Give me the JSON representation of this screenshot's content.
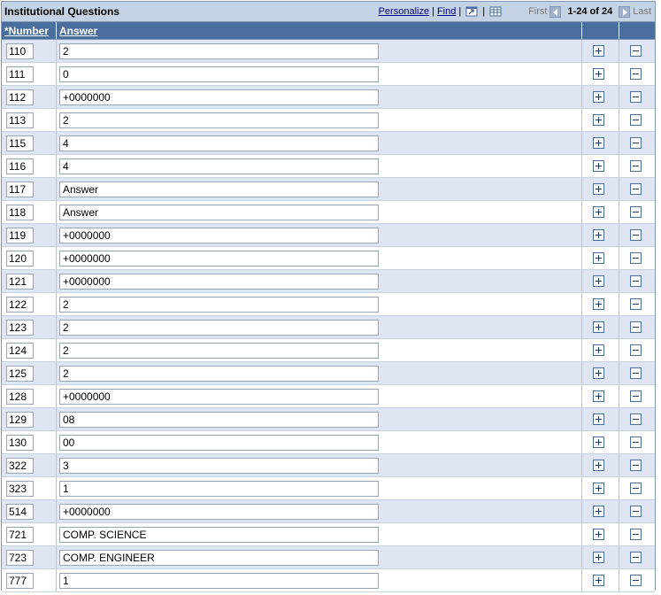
{
  "grid": {
    "title": "Institutional Questions",
    "nav": {
      "personalize": "Personalize",
      "find": "Find",
      "first": "First",
      "range": "1-24 of 24",
      "last": "Last"
    },
    "columns": {
      "number": "*Number",
      "answer": "Answer"
    },
    "rows": [
      {
        "number": "110",
        "answer": "2"
      },
      {
        "number": "111",
        "answer": "0"
      },
      {
        "number": "112",
        "answer": "+0000000"
      },
      {
        "number": "113",
        "answer": "2"
      },
      {
        "number": "115",
        "answer": "4"
      },
      {
        "number": "116",
        "answer": "4"
      },
      {
        "number": "117",
        "answer": "Answer"
      },
      {
        "number": "118",
        "answer": "Answer"
      },
      {
        "number": "119",
        "answer": "+0000000"
      },
      {
        "number": "120",
        "answer": "+0000000"
      },
      {
        "number": "121",
        "answer": "+0000000"
      },
      {
        "number": "122",
        "answer": "2"
      },
      {
        "number": "123",
        "answer": "2"
      },
      {
        "number": "124",
        "answer": "2"
      },
      {
        "number": "125",
        "answer": "2"
      },
      {
        "number": "128",
        "answer": "+0000000"
      },
      {
        "number": "129",
        "answer": "08"
      },
      {
        "number": "130",
        "answer": "00"
      },
      {
        "number": "322",
        "answer": "3"
      },
      {
        "number": "323",
        "answer": "1"
      },
      {
        "number": "514",
        "answer": "+0000000"
      },
      {
        "number": "721",
        "answer": "COMP. SCIENCE"
      },
      {
        "number": "723",
        "answer": "COMP. ENGINEER"
      },
      {
        "number": "777",
        "answer": "1"
      }
    ]
  },
  "icons": {
    "add": "plus-icon",
    "delete": "minus-icon",
    "view_all": "view-all-icon",
    "download": "spreadsheet-icon",
    "prev": "arrow-left-icon",
    "next": "arrow-right-icon"
  },
  "colors": {
    "title_bg": "#c4d3e4",
    "header_bg": "#4a6f9f",
    "row_alt_bg": "#dfe5f2",
    "link": "#000080"
  }
}
